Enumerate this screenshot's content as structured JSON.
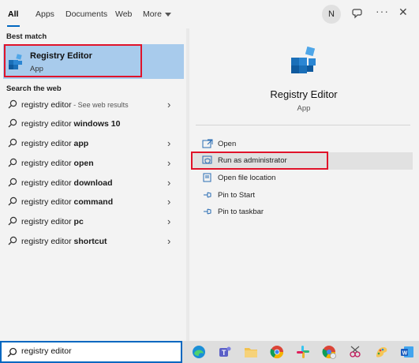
{
  "nav": {
    "tabs": [
      {
        "label": "All",
        "active": true
      },
      {
        "label": "Apps"
      },
      {
        "label": "Documents"
      },
      {
        "label": "Web"
      },
      {
        "label": "More"
      }
    ],
    "avatar_initial": "N",
    "more_options": "···",
    "close": "✕"
  },
  "left": {
    "best_match_header": "Best match",
    "best_match": {
      "title": "Registry Editor",
      "subtitle": "App"
    },
    "search_web_header": "Search the web",
    "web_results": [
      {
        "prefix": "registry editor",
        "bold": "",
        "suffix": " - See web results"
      },
      {
        "prefix": "registry editor ",
        "bold": "windows 10",
        "suffix": ""
      },
      {
        "prefix": "registry editor ",
        "bold": "app",
        "suffix": ""
      },
      {
        "prefix": "registry editor ",
        "bold": "open",
        "suffix": ""
      },
      {
        "prefix": "registry editor ",
        "bold": "download",
        "suffix": ""
      },
      {
        "prefix": "registry editor ",
        "bold": "command",
        "suffix": ""
      },
      {
        "prefix": "registry editor ",
        "bold": "pc",
        "suffix": ""
      },
      {
        "prefix": "registry editor ",
        "bold": "shortcut",
        "suffix": ""
      }
    ]
  },
  "right": {
    "app_title": "Registry Editor",
    "app_type": "App",
    "actions": [
      {
        "label": "Open",
        "icon": "open-icon"
      },
      {
        "label": "Run as administrator",
        "icon": "shield-icon"
      },
      {
        "label": "Open file location",
        "icon": "file-location-icon"
      },
      {
        "label": "Pin to Start",
        "icon": "pin-icon"
      },
      {
        "label": "Pin to taskbar",
        "icon": "pin-icon"
      }
    ]
  },
  "taskbar": {
    "search_value": "registry editor",
    "apps": [
      "edge-icon",
      "teams-icon",
      "file-explorer-icon",
      "chrome-icon",
      "slack-icon",
      "chrome-alt-icon",
      "snipping-tool-icon",
      "paint-icon",
      "word-icon"
    ]
  },
  "colors": {
    "accent": "#0067c0",
    "highlight": "#a8cbec",
    "annotation_red": "#e0132a"
  }
}
